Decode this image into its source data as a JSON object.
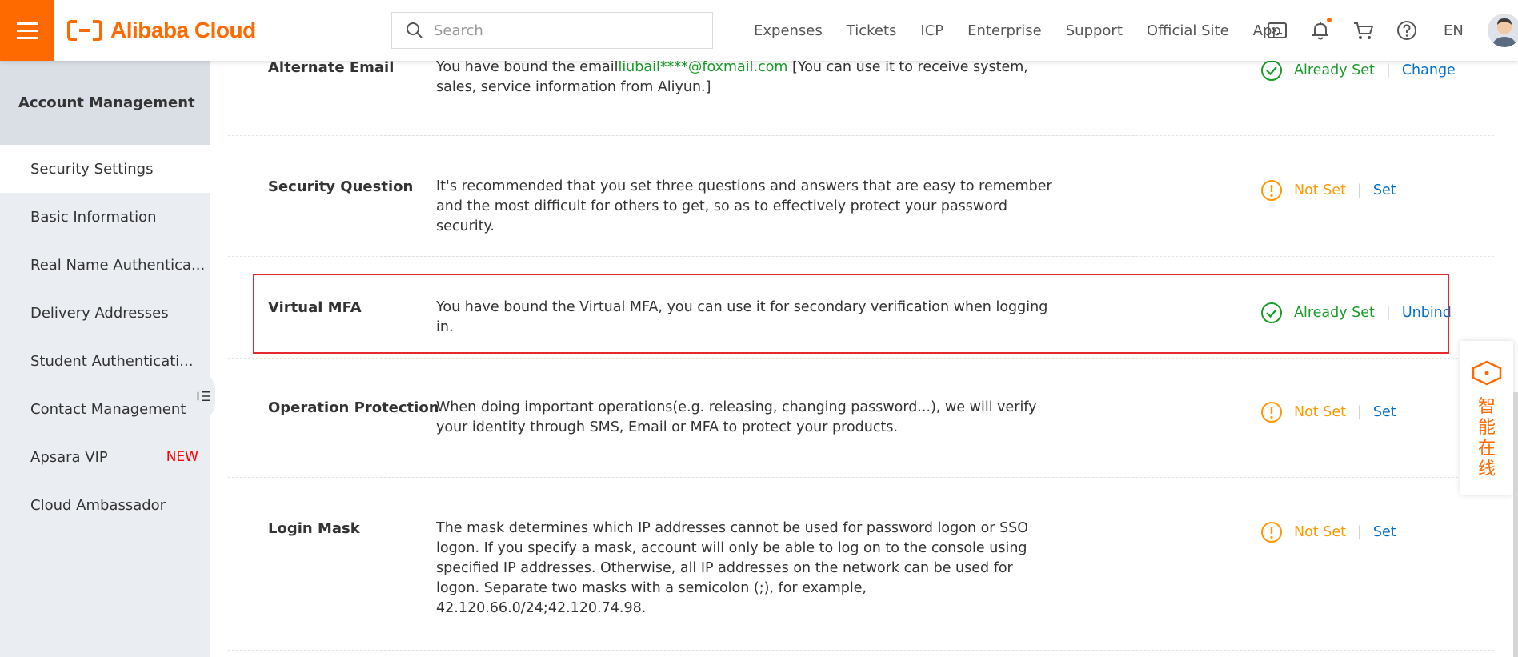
{
  "header": {
    "logo_text": "Alibaba Cloud",
    "search_placeholder": "Search",
    "nav": [
      "Expenses",
      "Tickets",
      "ICP",
      "Enterprise",
      "Support",
      "Official Site",
      "App"
    ],
    "lang": "EN",
    "brand_color": "#ff6a00"
  },
  "sidebar": {
    "title": "Account Management",
    "items": [
      {
        "label": "Security Settings",
        "active": true
      },
      {
        "label": "Basic Information"
      },
      {
        "label": "Real Name Authentica..."
      },
      {
        "label": "Delivery Addresses"
      },
      {
        "label": "Student Authenticati..."
      },
      {
        "label": "Contact Management"
      },
      {
        "label": "Apsara VIP",
        "badge": "NEW"
      },
      {
        "label": "Cloud Ambassador"
      }
    ]
  },
  "settings": [
    {
      "title": "Alternate Email",
      "desc_prefix": "You have bound the email",
      "email": "liubail****@foxmail.com",
      "desc_suffix": " [You can use it to receive system, sales, service information from Aliyun.]",
      "status": "Already Set",
      "action": "Change"
    },
    {
      "title": "Security Question",
      "desc": "It's recommended that you set three questions and answers that are easy to remember and the most difficult for others to get, so as to effectively protect your password security.",
      "status": "Not Set",
      "action": "Set"
    },
    {
      "title": "Virtual MFA",
      "desc": "You have bound the Virtual MFA, you can use it for secondary verification when logging in.",
      "status": "Already Set",
      "action": "Unbind"
    },
    {
      "title": "Operation Protection",
      "desc": "When doing important operations(e.g. releasing, changing password...), we will verify your identity through SMS, Email or MFA to protect your products.",
      "status": "Not Set",
      "action": "Set"
    },
    {
      "title": "Login Mask",
      "desc": "The mask determines which IP addresses cannot be used for password logon or SSO logon. If you specify a mask, account will only be able to log on to the console using specified IP addresses. Otherwise, all IP addresses on the network can be used for logon. Separate two masks with a semicolon (;), for example, 42.120.66.0/24;42.120.74.98.",
      "status": "Not Set",
      "action": "Set"
    }
  ],
  "separator": "|",
  "helper": {
    "label": "智能在线"
  },
  "colors": {
    "ok": "#1a9c2a",
    "warn": "#ff9900",
    "link": "#0070cc",
    "highlight": "#e42a2a"
  }
}
